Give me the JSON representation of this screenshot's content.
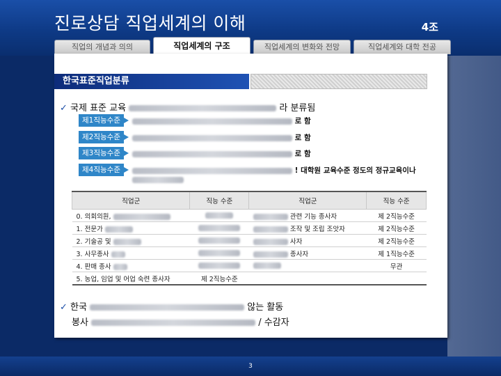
{
  "header": {
    "title": "진로상담 직업세계의 이해",
    "team": "4조"
  },
  "tabs": [
    {
      "label": "직업의 개념과 의의"
    },
    {
      "label": "직업세계의 구조"
    },
    {
      "label": "직업세계의 변화와 전망"
    },
    {
      "label": "직업세계와 대학 전공"
    }
  ],
  "section": {
    "title": "한국표준직업분류"
  },
  "bullet1": {
    "prefix": "국제 표준 교육",
    "suffix": "라 분류됨"
  },
  "levels": [
    {
      "label": "제1직능수준",
      "suffix": "로 함"
    },
    {
      "label": "제2직능수준",
      "suffix": "로 함"
    },
    {
      "label": "제3직능수준",
      "suffix": "로 함"
    },
    {
      "label": "제4직능수준",
      "suffix": "! 대학원 교육수준 정도의 정규교육이나"
    }
  ],
  "table": {
    "headers": [
      "직업군",
      "직능 수준",
      "직업군",
      "직능 수준"
    ],
    "rows": [
      [
        "0. 의회의원,",
        "",
        "관련 기능 종사자",
        "제 2직능수준"
      ],
      [
        "1. 전문가",
        "",
        "조작 및 조립 조앗자",
        "제 2직능수준"
      ],
      [
        "2. 기술공 및",
        "",
        "사자",
        "제 2직능수준"
      ],
      [
        "3. 사무종사",
        "",
        "종사자",
        "제 1직능수준"
      ],
      [
        "4. 판매 종사",
        "",
        "",
        "무관"
      ],
      [
        "5. 농업, 임업 및 어업 숙련 종사자",
        "제 2직능수준",
        "",
        ""
      ]
    ]
  },
  "bullet2": {
    "line1_prefix": "한국",
    "line1_suffix": "않는 활동",
    "line2_prefix": "봉사",
    "line2_suffix": "/ 수감자"
  },
  "footer": {
    "page": "3"
  }
}
